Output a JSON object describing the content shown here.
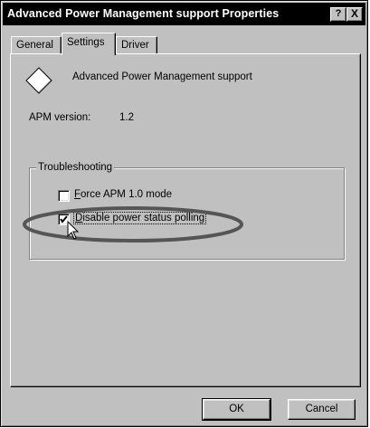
{
  "window": {
    "title": "Advanced Power Management support Properties",
    "help_glyph": "?",
    "close_glyph": "X"
  },
  "tabs": [
    {
      "label": "General",
      "active": false
    },
    {
      "label": "Settings",
      "active": true
    },
    {
      "label": "Driver",
      "active": false
    }
  ],
  "device": {
    "icon": "diamond-device-icon",
    "name": "Advanced Power Management support"
  },
  "apm": {
    "label": "APM version:",
    "value": "1.2"
  },
  "troubleshooting": {
    "title": "Troubleshooting",
    "options": [
      {
        "accel": "F",
        "rest": "orce APM 1.0 mode",
        "checked": false
      },
      {
        "accel": "D",
        "rest": "isable power status polling",
        "checked": true
      }
    ]
  },
  "annotation": {
    "highlight": "ellipse",
    "color": "#555555"
  },
  "buttons": {
    "ok": "OK",
    "cancel": "Cancel"
  },
  "colors": {
    "face": "#c0c0c0",
    "titlebar": "#000000",
    "highlight": "#ffffff",
    "shadow": "#808080"
  }
}
